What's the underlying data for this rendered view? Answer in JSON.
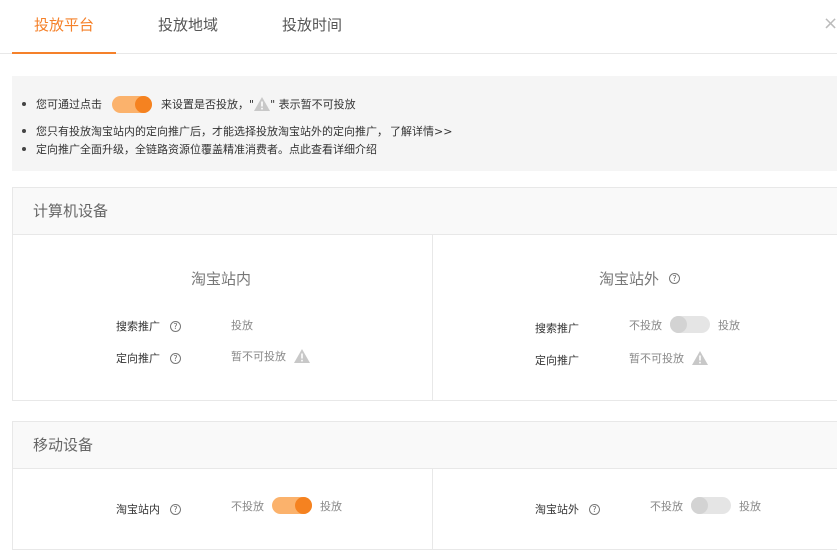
{
  "tabs": [
    {
      "label": "投放平台",
      "active": true
    },
    {
      "label": "投放地域",
      "active": false
    },
    {
      "label": "投放时间",
      "active": false
    }
  ],
  "close_icon": "×",
  "notice": {
    "line1_prefix": "您可通过点击",
    "line1_middle": "来设置是否投放，\"",
    "line1_suffix": "\" 表示暂不可投放",
    "line2_text": "您只有投放淘宝站内的定向推广后，才能选择投放淘宝站外的定向推广，",
    "line2_link": "了解详情>>",
    "line3_text": "定向推广全面升级，全链路资源位覆盖精准消费者。点此查看详细介绍"
  },
  "pc_section": {
    "title": "计算机设备",
    "inside": {
      "title": "淘宝站内",
      "search_label": "搜索推广",
      "search_value": "投放",
      "targeted_label": "定向推广",
      "targeted_value": "暂不可投放"
    },
    "outside": {
      "title": "淘宝站外",
      "search_label": "搜索推广",
      "search_off_label": "不投放",
      "search_on_label": "投放",
      "search_toggle_on": false,
      "targeted_label": "定向推广",
      "targeted_value": "暂不可投放"
    }
  },
  "mobile_section": {
    "title": "移动设备",
    "inside": {
      "label": "淘宝站内",
      "off_label": "不投放",
      "on_label": "投放",
      "toggle_on": true
    },
    "outside": {
      "label": "淘宝站外",
      "off_label": "不投放",
      "on_label": "投放",
      "toggle_on": false
    }
  },
  "help_glyph": "?",
  "colors": {
    "accent": "#f5812a",
    "toggle_on_track": "#fbb26c",
    "toggle_on_knob": "#f58220",
    "toggle_off_track": "#e5e5e5"
  }
}
